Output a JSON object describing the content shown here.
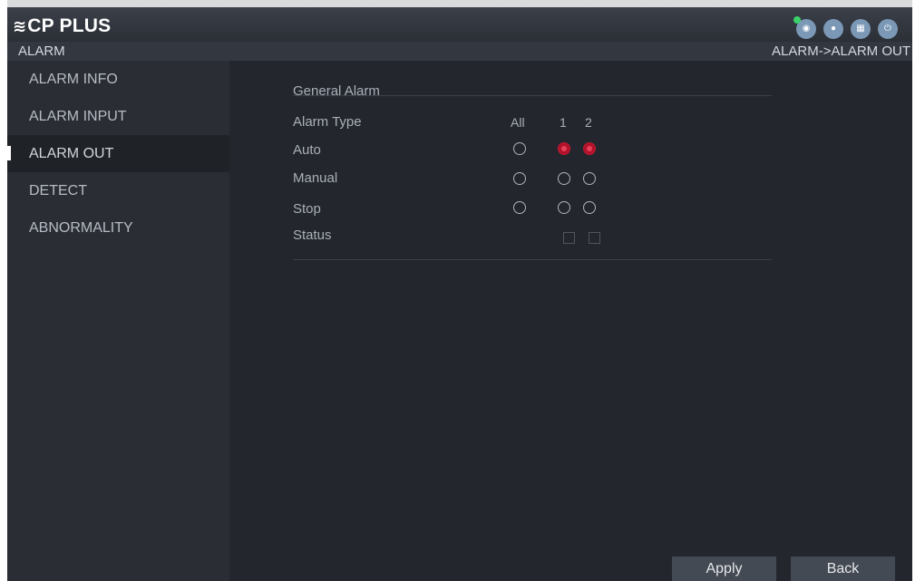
{
  "brand": {
    "logo_mark": "≋",
    "logo_text": "CP PLUS"
  },
  "topbar": {
    "icons": [
      {
        "name": "eye-icon",
        "glyph": "◉",
        "has_status_dot": true
      },
      {
        "name": "user-icon",
        "glyph": "●"
      },
      {
        "name": "keyboard-icon",
        "glyph": "▦"
      },
      {
        "name": "power-icon",
        "glyph": "⏻"
      }
    ],
    "status_dot_color": "#3ad16a",
    "icon_color": "#7b98b7"
  },
  "header": {
    "section": "ALARM",
    "breadcrumb": "ALARM->ALARM OUT"
  },
  "sidebar": {
    "items": [
      {
        "label": "ALARM INFO",
        "active": false
      },
      {
        "label": "ALARM INPUT",
        "active": false
      },
      {
        "label": "ALARM OUT",
        "active": true
      },
      {
        "label": "DETECT",
        "active": false
      },
      {
        "label": "ABNORMALITY",
        "active": false
      }
    ]
  },
  "form": {
    "section_title": "General Alarm",
    "header_label": "Alarm Type",
    "columns": [
      "All",
      "1",
      "2"
    ],
    "rows": [
      {
        "label": "Auto",
        "all": false,
        "ch1": true,
        "ch2": true
      },
      {
        "label": "Manual",
        "all": false,
        "ch1": false,
        "ch2": false
      },
      {
        "label": "Stop",
        "all": false,
        "ch1": false,
        "ch2": false
      }
    ],
    "status_label": "Status",
    "status": [
      false,
      false
    ],
    "selected_color": "#c01a33"
  },
  "buttons": {
    "apply": "Apply",
    "back": "Back"
  }
}
